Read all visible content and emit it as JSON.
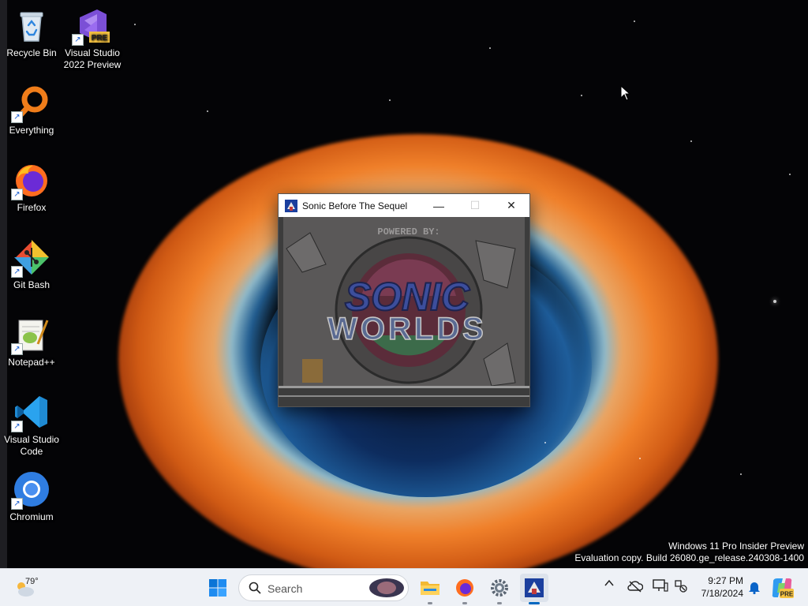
{
  "desktop": {
    "icons": [
      {
        "label": "Recycle Bin"
      },
      {
        "label": "Visual Studio 2022 Preview",
        "badge": "PRE"
      },
      {
        "label": "Everything"
      },
      {
        "label": "Firefox"
      },
      {
        "label": "Git Bash"
      },
      {
        "label": "Notepad++"
      },
      {
        "label": "Visual Studio Code"
      },
      {
        "label": "Chromium"
      }
    ]
  },
  "window": {
    "title": "Sonic Before The Sequel",
    "controls": {
      "minimize": "—",
      "maximize": "☐",
      "close": "✕"
    },
    "splash": {
      "powered_by": "POWERED BY:",
      "logo_line1": "SONIC",
      "logo_line2": "WORLDS"
    }
  },
  "watermark": {
    "line1": "Windows 11 Pro Insider Preview",
    "line2": "Evaluation copy. Build 26080.ge_release.240308-1400"
  },
  "taskbar": {
    "weather_temp": "79°",
    "search_label": "Search",
    "clock_time": "9:27 PM",
    "clock_date": "7/18/2024",
    "copilot_badge": "PRE"
  },
  "colors": {
    "accent": "#0067c0",
    "taskbar_bg": "#eef1f6"
  }
}
